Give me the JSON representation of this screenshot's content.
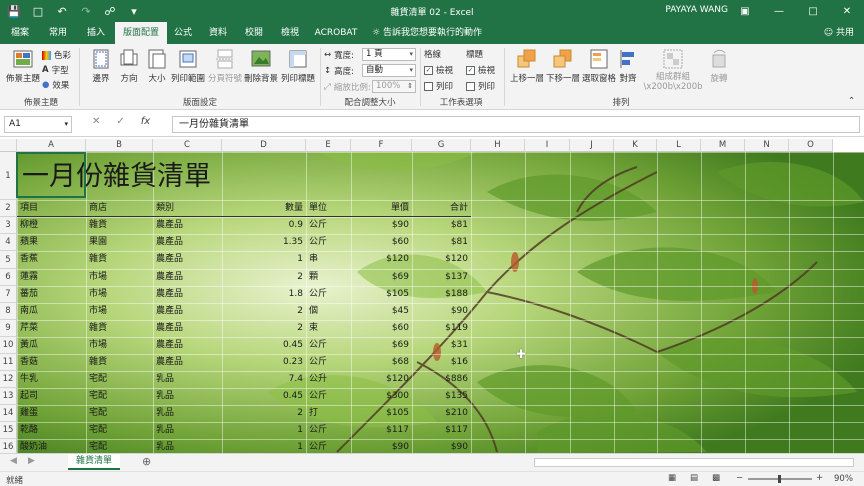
{
  "window": {
    "title": "雜貨清單 02  -  Excel",
    "user": "PAYAYA WANG",
    "quick_access": [
      "save-icon",
      "file-icon",
      "undo-icon",
      "redo-icon",
      "print-preview-icon",
      "dropdown-icon"
    ]
  },
  "tabs": [
    "檔案",
    "常用",
    "插入",
    "版面配置",
    "公式",
    "資料",
    "校閱",
    "檢視",
    "ACROBAT"
  ],
  "active_tab": "版面配置",
  "tell_me": "告訴我您想要執行的動作",
  "share": "共用",
  "ribbon": {
    "themes_group": {
      "label": "佈景主題",
      "theme_btn": "佈景主題",
      "colors": "色彩",
      "fonts": "字型",
      "effects": "效果"
    },
    "page_setup_group": {
      "label": "版面設定",
      "buttons": [
        "邊界",
        "方向",
        "大小",
        "列印範圍",
        "分頁符號",
        "刪除背景",
        "列印標題"
      ]
    },
    "scale_group": {
      "label": "配合調整大小",
      "width_label": "寬度:",
      "width_value": "1 頁",
      "height_label": "高度:",
      "height_value": "自動",
      "scale_label": "縮放比例:",
      "scale_value": "100%"
    },
    "sheet_options_group": {
      "label": "工作表選項",
      "gridlines": "格線",
      "headings": "標題",
      "view": "檢視",
      "print": "列印"
    },
    "arrange_group": {
      "label": "排列",
      "buttons": [
        "上移一層",
        "下移一層",
        "選取窗格",
        "對齊",
        "組成群組\\x200b\\x200b",
        "旋轉"
      ]
    }
  },
  "formula_bar": {
    "name_box": "A1",
    "fx": "fx",
    "content": "一月份雜貨清單"
  },
  "columns": [
    "A",
    "B",
    "C",
    "D",
    "E",
    "F",
    "G",
    "H",
    "I",
    "J",
    "K",
    "L",
    "M",
    "N",
    "O"
  ],
  "rows": [
    "1",
    "2",
    "3",
    "4",
    "5",
    "6",
    "7",
    "8",
    "9",
    "10",
    "11",
    "12",
    "13",
    "14",
    "15",
    "16"
  ],
  "sheet_title": "一月份雜貨清單",
  "headers": {
    "item": "項目",
    "store": "商店",
    "category": "類別",
    "qty": "數量",
    "unit": "單位",
    "price": "單價",
    "total": "合計"
  },
  "table": [
    [
      "柳橙",
      "雜貨",
      "農產品",
      "0.9",
      "公斤",
      "$90",
      "$81"
    ],
    [
      "蘋果",
      "果園",
      "農產品",
      "1.35",
      "公斤",
      "$60",
      "$81"
    ],
    [
      "香蕉",
      "雜貨",
      "農產品",
      "1",
      "串",
      "$120",
      "$120"
    ],
    [
      "蓮霧",
      "市場",
      "農產品",
      "2",
      "顆",
      "$69",
      "$137"
    ],
    [
      "蕃茄",
      "市場",
      "農產品",
      "1.8",
      "公斤",
      "$105",
      "$188"
    ],
    [
      "南瓜",
      "市場",
      "農產品",
      "2",
      "個",
      "$45",
      "$90"
    ],
    [
      "芹菜",
      "雜貨",
      "農產品",
      "2",
      "束",
      "$60",
      "$119"
    ],
    [
      "黃瓜",
      "市場",
      "農產品",
      "0.45",
      "公斤",
      "$69",
      "$31"
    ],
    [
      "香菇",
      "雜貨",
      "農產品",
      "0.23",
      "公斤",
      "$68",
      "$16"
    ],
    [
      "牛乳",
      "宅配",
      "乳品",
      "7.4",
      "公升",
      "$120",
      "$886"
    ],
    [
      "起司",
      "宅配",
      "乳品",
      "0.45",
      "公斤",
      "$300",
      "$135"
    ],
    [
      "雞蛋",
      "宅配",
      "乳品",
      "2",
      "打",
      "$105",
      "$210"
    ],
    [
      "乾酪",
      "宅配",
      "乳品",
      "1",
      "公斤",
      "$117",
      "$117"
    ],
    [
      "酸奶油",
      "宅配",
      "乳品",
      "1",
      "公斤",
      "$90",
      "$90"
    ]
  ],
  "sheet_tab": "雜貨清單",
  "status": {
    "left": "就緒",
    "zoom": "90%"
  }
}
